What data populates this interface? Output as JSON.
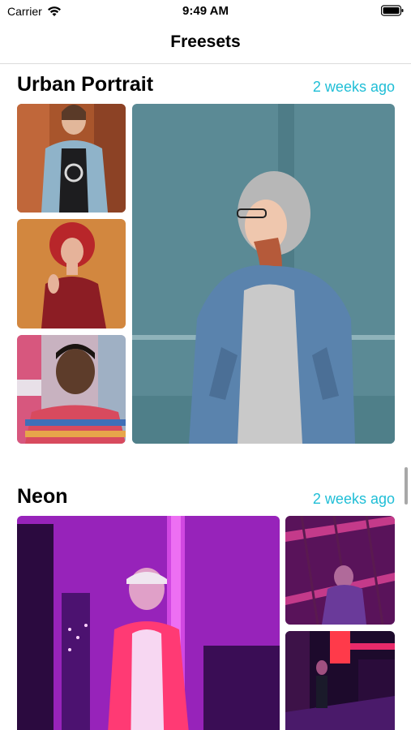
{
  "status_bar": {
    "carrier": "Carrier",
    "time": "9:49 AM",
    "wifi_icon": "wifi-icon",
    "battery_icon": "battery-icon"
  },
  "nav": {
    "title": "Freesets"
  },
  "sections": [
    {
      "title": "Urban Portrait",
      "time": "2 weeks ago",
      "photos": [
        "woman-denim-jacket-photo",
        "red-hair-woman-photo",
        "man-striped-shirt-photo",
        "woman-gray-hoodie-photo"
      ]
    },
    {
      "title": "Neon",
      "time": "2 weeks ago",
      "photos": [
        "neon-woman-seated-photo",
        "neon-man-stairs-photo",
        "neon-alley-photo"
      ]
    }
  ],
  "colors": {
    "accent": "#1fbed6",
    "neon_magenta": "#c81ed6",
    "neon_purple": "#5a1490"
  }
}
